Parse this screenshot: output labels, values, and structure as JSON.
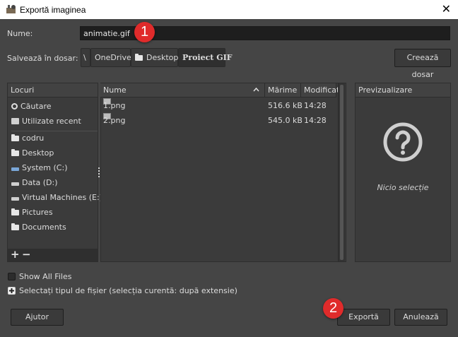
{
  "window": {
    "title": "Exportă imaginea",
    "app_icon": "gimp-icon",
    "close_icon": "close-icon"
  },
  "name_row": {
    "label": "Nume:",
    "value": "animatie.gif"
  },
  "folder_row": {
    "label": "Salvează în dosar:",
    "path": [
      "\\",
      "OneDrive",
      "Desktop",
      "Proiect GIF"
    ],
    "create_folder": "Creează dosar"
  },
  "places": {
    "header": "Locuri",
    "items": [
      {
        "label": "Căutare",
        "icon": "search-icon"
      },
      {
        "label": "Utilizate recent",
        "icon": "recent-icon"
      },
      {
        "label": "codru",
        "icon": "folder-icon"
      },
      {
        "label": "Desktop",
        "icon": "folder-icon"
      },
      {
        "label": "System (C:)",
        "icon": "drive-icon"
      },
      {
        "label": "Data (D:)",
        "icon": "drive-icon"
      },
      {
        "label": "Virtual Machines (E:)",
        "icon": "drive-icon"
      },
      {
        "label": "Pictures",
        "icon": "folder-icon"
      },
      {
        "label": "Documents",
        "icon": "folder-icon"
      }
    ],
    "add": "+",
    "remove": "−"
  },
  "files": {
    "columns": [
      "Nume",
      "Mărime",
      "Modificat"
    ],
    "rows": [
      {
        "name": "1.png",
        "size": "516.6 kB",
        "modified": "14:28"
      },
      {
        "name": "2.png",
        "size": "545.0 kB",
        "modified": "14:28"
      }
    ]
  },
  "preview": {
    "header": "Previzualizare",
    "empty_text": "Nicio selecție"
  },
  "options": {
    "show_all": "Show All Files",
    "file_type": "Selectați tipul de fișier (selecția curentă: după extensie)"
  },
  "buttons": {
    "help": "Ajutor",
    "export": "Exportă",
    "cancel": "Anulează"
  },
  "markers": [
    "1",
    "2"
  ],
  "colors": {
    "background": "#454545",
    "marker": "#e02b2b",
    "field": "#1e1e1e"
  }
}
